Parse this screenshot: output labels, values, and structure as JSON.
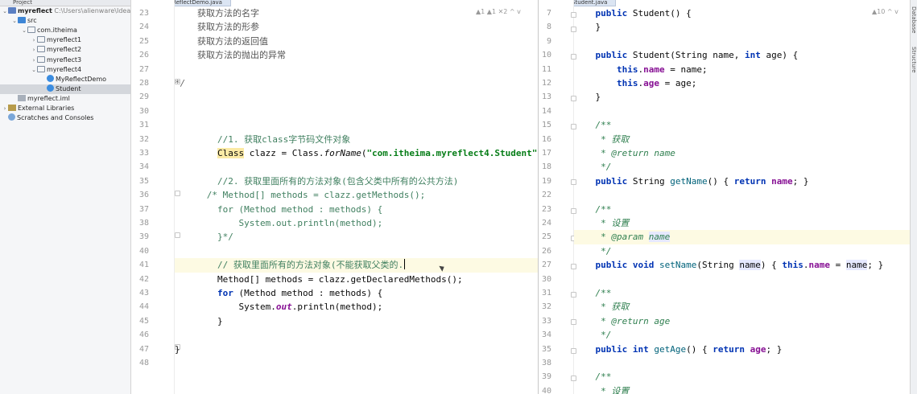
{
  "project_panel": {
    "header": "Project",
    "items": [
      {
        "label": "myreflect",
        "path": "C:\\Users\\alienware\\IdeaProj",
        "type": "module",
        "arrow": "v"
      },
      {
        "label": "src",
        "type": "src",
        "arrow": "v"
      },
      {
        "label": "com.itheima",
        "type": "package",
        "arrow": "v"
      },
      {
        "label": "myreflect1",
        "type": "package",
        "arrow": ">"
      },
      {
        "label": "myreflect2",
        "type": "package",
        "arrow": ">"
      },
      {
        "label": "myreflect3",
        "type": "package",
        "arrow": ">"
      },
      {
        "label": "myreflect4",
        "type": "package",
        "arrow": "v"
      },
      {
        "label": "MyReflectDemo",
        "type": "class",
        "arrow": ""
      },
      {
        "label": "Student",
        "type": "class",
        "arrow": "",
        "selected": true
      },
      {
        "label": "myreflect.iml",
        "type": "iml",
        "arrow": ""
      },
      {
        "label": "External Libraries",
        "type": "lib",
        "arrow": ">"
      },
      {
        "label": "Scratches and Consoles",
        "type": "scratch",
        "arrow": ""
      }
    ]
  },
  "left_editor": {
    "tab": "MyReflectDemo.java",
    "inspections": "▲1  ▲1  ✕2  ^  v",
    "lines": [
      {
        "n": "23",
        "tokens": [
          [
            "        获取方法的名字",
            "cmtz"
          ]
        ]
      },
      {
        "n": "24",
        "tokens": [
          [
            "        获取方法的形参",
            "cmtz"
          ]
        ]
      },
      {
        "n": "25",
        "tokens": [
          [
            "        获取方法的返回值",
            "cmtz"
          ]
        ]
      },
      {
        "n": "26",
        "tokens": [
          [
            "        获取方法的抛出的异常",
            "cmtz"
          ]
        ]
      },
      {
        "n": "27",
        "tokens": []
      },
      {
        "n": "28",
        "tokens": [
          [
            "*/",
            "cm"
          ]
        ]
      },
      {
        "n": "29",
        "tokens": []
      },
      {
        "n": "30",
        "tokens": []
      },
      {
        "n": "31",
        "tokens": []
      },
      {
        "n": "32",
        "tokens": [
          [
            "        //1. 获取class字节码文件对象",
            "cmg"
          ]
        ]
      },
      {
        "n": "33",
        "tokens": [
          [
            "        ",
            ""
          ],
          [
            "Class",
            "cls-hl"
          ],
          [
            " clazz = Class.",
            ""
          ],
          [
            "forName",
            "it"
          ],
          [
            "(",
            ""
          ],
          [
            "\"com.itheima.myreflect4.Student\"",
            "str"
          ],
          [
            ");",
            ""
          ]
        ]
      },
      {
        "n": "34",
        "tokens": []
      },
      {
        "n": "35",
        "tokens": [
          [
            "        //2. 获取里面所有的方法对象(包含父类中所有的公共方法)",
            "cmg"
          ]
        ]
      },
      {
        "n": "36",
        "tokens": [
          [
            "      /* Method[] methods = clazz.getMethods();",
            "cmg"
          ]
        ]
      },
      {
        "n": "37",
        "tokens": [
          [
            "        for (Method method : methods) {",
            "cmg"
          ]
        ]
      },
      {
        "n": "38",
        "tokens": [
          [
            "            System.out.println(method);",
            "cmg"
          ]
        ]
      },
      {
        "n": "39",
        "tokens": [
          [
            "        }*/",
            "cmg"
          ]
        ]
      },
      {
        "n": "40",
        "tokens": []
      },
      {
        "n": "41",
        "tokens": [
          [
            "        // 获取里面所有的方法对象(不能获取父类的.",
            "cmg"
          ]
        ],
        "hl": true,
        "caret": true
      },
      {
        "n": "42",
        "tokens": [
          [
            "        Method[] methods = clazz.getDeclaredMethods();",
            ""
          ]
        ]
      },
      {
        "n": "43",
        "tokens": [
          [
            "        ",
            ""
          ],
          [
            "for",
            "kw"
          ],
          [
            " (Method method : methods) {",
            ""
          ]
        ]
      },
      {
        "n": "44",
        "tokens": [
          [
            "            System.",
            ""
          ],
          [
            "out",
            "fld it"
          ],
          [
            ".println(method);",
            ""
          ]
        ]
      },
      {
        "n": "45",
        "tokens": [
          [
            "        }",
            ""
          ]
        ]
      },
      {
        "n": "46",
        "tokens": []
      },
      {
        "n": "47",
        "tokens": [
          [
            "}",
            ""
          ]
        ]
      },
      {
        "n": "48",
        "tokens": []
      }
    ]
  },
  "right_editor": {
    "tab": "Student.java",
    "inspections": "▲10  ^  v",
    "lines": [
      {
        "n": "7",
        "tokens": [
          [
            "    ",
            ""
          ],
          [
            "public",
            "kw"
          ],
          [
            " Student() {",
            ""
          ]
        ]
      },
      {
        "n": "8",
        "tokens": [
          [
            "    }",
            ""
          ]
        ]
      },
      {
        "n": "9",
        "tokens": []
      },
      {
        "n": "10",
        "tokens": [
          [
            "    ",
            ""
          ],
          [
            "public",
            "kw"
          ],
          [
            " Student(String name, ",
            ""
          ],
          [
            "int",
            "kw"
          ],
          [
            " age) {",
            ""
          ]
        ]
      },
      {
        "n": "11",
        "tokens": [
          [
            "        ",
            ""
          ],
          [
            "this",
            "kw"
          ],
          [
            ".",
            ""
          ],
          [
            "name",
            "fld"
          ],
          [
            " = name;",
            ""
          ]
        ]
      },
      {
        "n": "12",
        "tokens": [
          [
            "        ",
            ""
          ],
          [
            "this",
            "kw"
          ],
          [
            ".",
            ""
          ],
          [
            "age",
            "fld"
          ],
          [
            " = age;",
            ""
          ]
        ]
      },
      {
        "n": "13",
        "tokens": [
          [
            "    }",
            ""
          ]
        ]
      },
      {
        "n": "14",
        "tokens": []
      },
      {
        "n": "15",
        "tokens": [
          [
            "    /**",
            "jd"
          ]
        ]
      },
      {
        "n": "16",
        "tokens": [
          [
            "     * 获取",
            "jd"
          ]
        ]
      },
      {
        "n": "17",
        "tokens": [
          [
            "     * ",
            "jd"
          ],
          [
            "@return",
            "jd"
          ],
          [
            " name",
            "jd"
          ]
        ]
      },
      {
        "n": "18",
        "tokens": [
          [
            "     */",
            "jd"
          ]
        ]
      },
      {
        "n": "19",
        "tokens": [
          [
            "    ",
            ""
          ],
          [
            "public",
            "kw"
          ],
          [
            " String ",
            ""
          ],
          [
            "getName",
            "mth"
          ],
          [
            "() { ",
            ""
          ],
          [
            "return",
            "kw"
          ],
          [
            " ",
            ""
          ],
          [
            "name",
            "fld"
          ],
          [
            "; }",
            ""
          ]
        ]
      },
      {
        "n": "22",
        "tokens": []
      },
      {
        "n": "23",
        "tokens": [
          [
            "    /**",
            "jd"
          ]
        ]
      },
      {
        "n": "24",
        "tokens": [
          [
            "     * 设置",
            "jd"
          ]
        ]
      },
      {
        "n": "25",
        "tokens": [
          [
            "     * ",
            "jd"
          ],
          [
            "@param",
            "jd"
          ],
          [
            " ",
            "jd"
          ],
          [
            "name",
            "jd par"
          ]
        ],
        "hl": true
      },
      {
        "n": "26",
        "tokens": [
          [
            "     */",
            "jd"
          ]
        ]
      },
      {
        "n": "27",
        "tokens": [
          [
            "    ",
            ""
          ],
          [
            "public",
            "kw"
          ],
          [
            " ",
            ""
          ],
          [
            "void",
            "kw"
          ],
          [
            " ",
            ""
          ],
          [
            "setName",
            "mth"
          ],
          [
            "(String ",
            ""
          ],
          [
            "name",
            "par"
          ],
          [
            ") { ",
            ""
          ],
          [
            "this",
            "kw"
          ],
          [
            ".",
            ""
          ],
          [
            "name",
            "fld"
          ],
          [
            " = ",
            ""
          ],
          [
            "name",
            "par"
          ],
          [
            "; }",
            ""
          ]
        ]
      },
      {
        "n": "30",
        "tokens": []
      },
      {
        "n": "31",
        "tokens": [
          [
            "    /**",
            "jd"
          ]
        ]
      },
      {
        "n": "32",
        "tokens": [
          [
            "     * 获取",
            "jd"
          ]
        ]
      },
      {
        "n": "33",
        "tokens": [
          [
            "     * ",
            "jd"
          ],
          [
            "@return",
            "jd"
          ],
          [
            " age",
            "jd"
          ]
        ]
      },
      {
        "n": "34",
        "tokens": [
          [
            "     */",
            "jd"
          ]
        ]
      },
      {
        "n": "35",
        "tokens": [
          [
            "    ",
            ""
          ],
          [
            "public",
            "kw"
          ],
          [
            " ",
            ""
          ],
          [
            "int",
            "kw"
          ],
          [
            " ",
            ""
          ],
          [
            "getAge",
            "mth"
          ],
          [
            "() { ",
            ""
          ],
          [
            "return",
            "kw"
          ],
          [
            " ",
            ""
          ],
          [
            "age",
            "fld"
          ],
          [
            "; }",
            ""
          ]
        ]
      },
      {
        "n": "38",
        "tokens": []
      },
      {
        "n": "39",
        "tokens": [
          [
            "    /**",
            "jd"
          ]
        ]
      },
      {
        "n": "40",
        "tokens": [
          [
            "     * 设置",
            "jd"
          ]
        ]
      }
    ]
  },
  "side_tools": {
    "database": "Database",
    "structure": "Structure"
  }
}
